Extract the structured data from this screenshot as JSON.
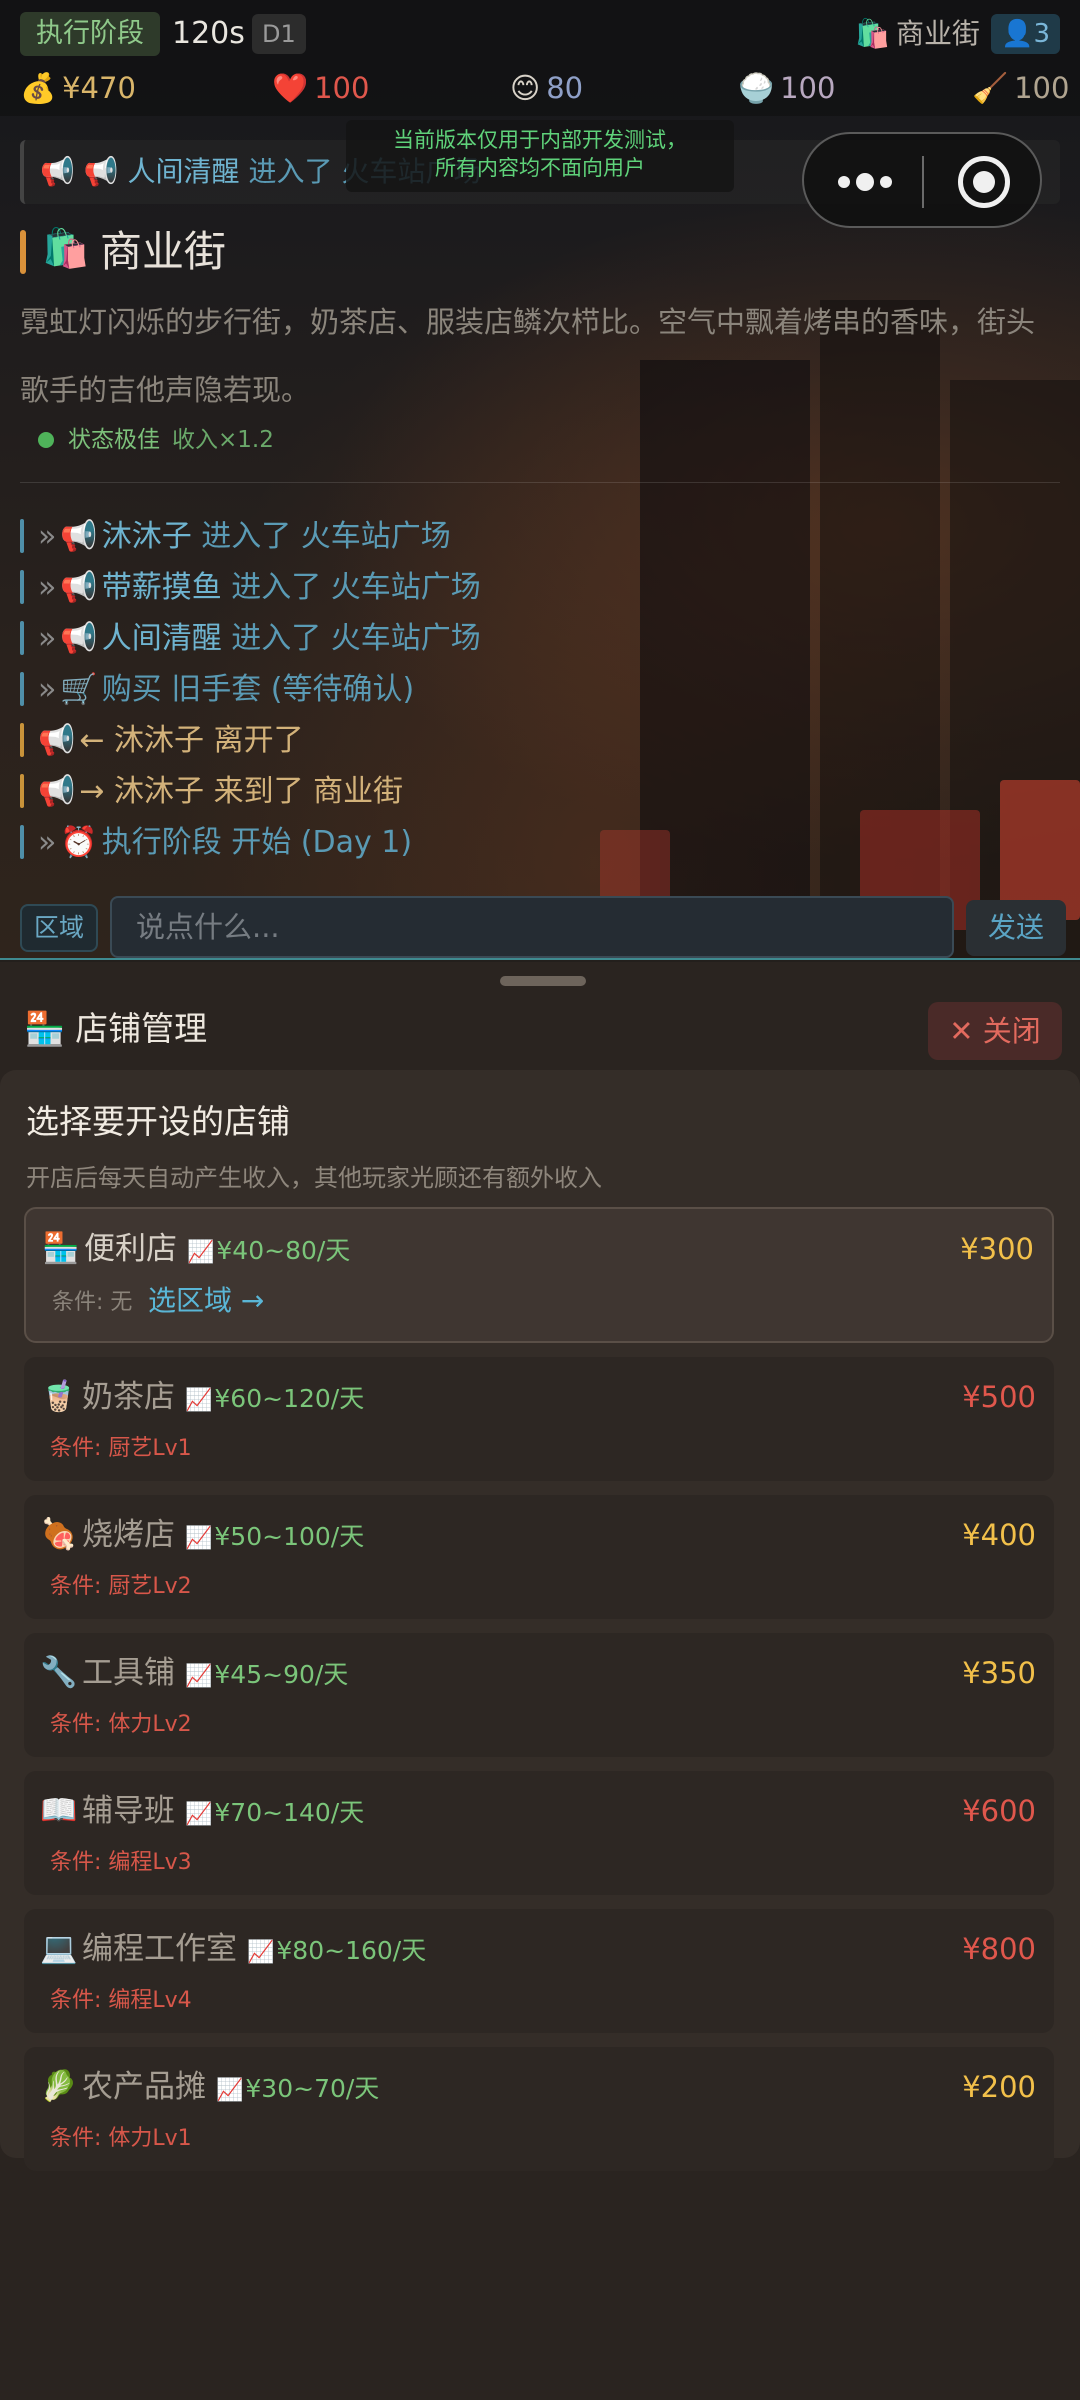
{
  "header": {
    "phase": "执行阶段",
    "timer": "120s",
    "day": "D1",
    "location": "商业街",
    "location_icon": "🛍️",
    "players": "👤3"
  },
  "stats": {
    "money": {
      "icon": "💰",
      "value": "¥470",
      "color": "#d9b56a"
    },
    "health": {
      "icon": "❤️",
      "value": "100",
      "color": "#e0574c"
    },
    "mood": {
      "icon": "😊",
      "value": "80",
      "color": "#8fa0c8"
    },
    "food": {
      "icon": "🍚",
      "value": "100",
      "color": "#b8a8c0"
    },
    "energy": {
      "icon": "🧹",
      "value": "100",
      "color": "#b0a490"
    }
  },
  "dev_notice": {
    "line1": "当前版本仅用于内部开发测试，",
    "line2": "所有内容均不面向用户"
  },
  "announcement": {
    "icons": "📢 📢",
    "name": "人间清醒",
    "text": " 进入了 火车站广场"
  },
  "location_panel": {
    "icon": "🛍️",
    "title": "商业街",
    "description": "霓虹灯闪烁的步行街，奶茶店、服装店鳞次栉比。空气中飘着烤串的香味，街头歌手的吉他声隐若现。",
    "status": "状态极佳",
    "income_multiplier": "收入×1.2"
  },
  "log": [
    {
      "type": "blue",
      "prefix": "»",
      "icon": "📢",
      "name": "沐沐子",
      "text": " 进入了 火车站广场"
    },
    {
      "type": "blue",
      "prefix": "»",
      "icon": "📢",
      "name": "带薪摸鱼",
      "text": " 进入了 火车站广场"
    },
    {
      "type": "blue",
      "prefix": "»",
      "icon": "📢",
      "name": "人间清醒",
      "text": " 进入了 火车站广场"
    },
    {
      "type": "blue",
      "prefix": "»",
      "icon": "🛒",
      "name": "",
      "text": "购买 旧手套 (等待确认)"
    },
    {
      "type": "gold",
      "prefix": "",
      "icon": "📢",
      "name": "",
      "text": "← 沐沐子 离开了"
    },
    {
      "type": "gold",
      "prefix": "",
      "icon": "📢",
      "name": "",
      "text": "→ 沐沐子 来到了 商业街"
    },
    {
      "type": "blue",
      "prefix": "»",
      "icon": "⏰",
      "name": "",
      "text": "执行阶段 开始 (Day 1)"
    }
  ],
  "chat": {
    "area_label": "区域",
    "placeholder": "说点什么...",
    "send_label": "发送"
  },
  "sheet": {
    "icon": "🏪",
    "title": "店铺管理",
    "close_label": "✕ 关闭",
    "panel_title": "选择要开设的店铺",
    "panel_subtitle": "开店后每天自动产生收入，其他玩家光顾还有额外收入",
    "chart_icon": "📈",
    "shops": [
      {
        "icon": "🏪",
        "name": "便利店",
        "income": "¥40~80/天",
        "price": "¥300",
        "affordable": true,
        "condition": "条件: 无",
        "action": "选区域 →"
      },
      {
        "icon": "🧋",
        "name": "奶茶店",
        "income": "¥60~120/天",
        "price": "¥500",
        "affordable": false,
        "condition": "条件: 厨艺Lv1"
      },
      {
        "icon": "🍖",
        "name": "烧烤店",
        "income": "¥50~100/天",
        "price": "¥400",
        "affordable": true,
        "condition": "条件: 厨艺Lv2"
      },
      {
        "icon": "🔧",
        "name": "工具铺",
        "income": "¥45~90/天",
        "price": "¥350",
        "affordable": true,
        "condition": "条件: 体力Lv2"
      },
      {
        "icon": "📖",
        "name": "辅导班",
        "income": "¥70~140/天",
        "price": "¥600",
        "affordable": false,
        "condition": "条件: 编程Lv3"
      },
      {
        "icon": "💻",
        "name": "编程工作室",
        "income": "¥80~160/天",
        "price": "¥800",
        "affordable": false,
        "condition": "条件: 编程Lv4"
      },
      {
        "icon": "🥬",
        "name": "农产品摊",
        "income": "¥30~70/天",
        "price": "¥200",
        "affordable": true,
        "condition": "条件: 体力Lv1"
      }
    ]
  }
}
